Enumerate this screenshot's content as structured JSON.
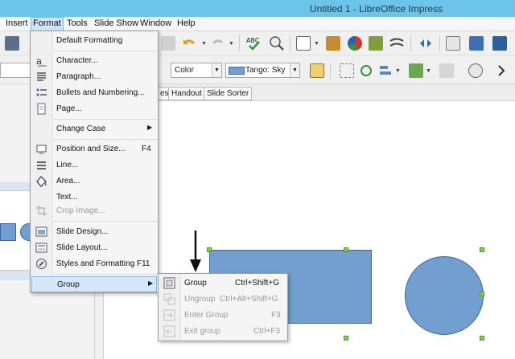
{
  "window": {
    "title": "Untitled 1 - LibreOffice Impress"
  },
  "menubar": {
    "items": [
      "Insert",
      "Format",
      "Tools",
      "Slide Show",
      "Window",
      "Help"
    ],
    "active": "Format"
  },
  "toolbar": {
    "area_style": "Color",
    "area_fill": "Tango: Sky",
    "area_fill_color": "#729fcf"
  },
  "tabs": [
    "es",
    "Handout",
    "Slide Sorter"
  ],
  "format_menu": {
    "items": [
      {
        "label": "Default Formatting",
        "icon": "default-formatting-icon",
        "enabled": true
      },
      {
        "label": "Character...",
        "icon": "character-icon",
        "enabled": true
      },
      {
        "label": "Paragraph...",
        "icon": "paragraph-icon",
        "enabled": true
      },
      {
        "label": "Bullets and Numbering...",
        "icon": "bullets-icon",
        "enabled": true
      },
      {
        "label": "Page...",
        "icon": "page-icon",
        "enabled": true
      },
      {
        "label": "Change Case",
        "icon": "",
        "enabled": true,
        "submenu": true
      },
      {
        "label": "Position and Size...",
        "icon": "position-size-icon",
        "enabled": true,
        "shortcut": "F4"
      },
      {
        "label": "Line...",
        "icon": "line-icon",
        "enabled": true
      },
      {
        "label": "Area...",
        "icon": "area-icon",
        "enabled": true
      },
      {
        "label": "Text...",
        "icon": "",
        "enabled": true
      },
      {
        "label": "Crop Image...",
        "icon": "crop-icon",
        "enabled": false
      },
      {
        "label": "Slide Design...",
        "icon": "slide-design-icon",
        "enabled": true
      },
      {
        "label": "Slide Layout...",
        "icon": "slide-layout-icon",
        "enabled": true
      },
      {
        "label": "Styles and Formatting",
        "icon": "styles-icon",
        "enabled": true,
        "shortcut": "F11"
      },
      {
        "label": "Group",
        "icon": "",
        "enabled": true,
        "submenu": true,
        "highlighted": true
      }
    ]
  },
  "group_submenu": {
    "items": [
      {
        "label": "Group",
        "shortcut": "Ctrl+Shift+G",
        "enabled": true
      },
      {
        "label": "Ungroup",
        "shortcut": "Ctrl+Alt+Shift+G",
        "enabled": false
      },
      {
        "label": "Enter Group",
        "shortcut": "F3",
        "enabled": false
      },
      {
        "label": "Exit group",
        "shortcut": "Ctrl+F3",
        "enabled": false
      }
    ]
  },
  "colors": {
    "titlebar": "#6cc4e9",
    "shape_fill": "#729fcf",
    "shape_border": "#3465a4",
    "handle": "#7cd243",
    "highlight": "#d5e7f8"
  }
}
